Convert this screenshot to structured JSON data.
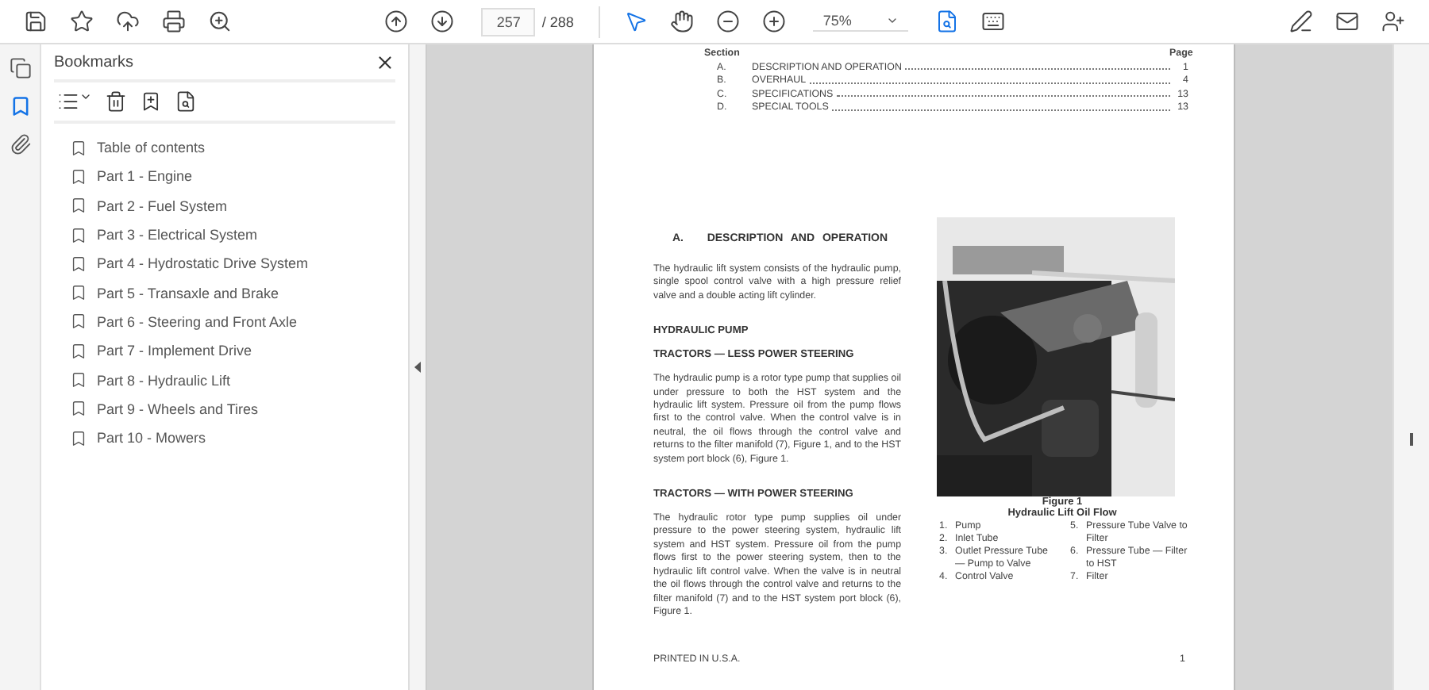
{
  "toolbar": {
    "page_current": "257",
    "page_total": "/ 288",
    "zoom": "75%"
  },
  "rail": [
    {
      "kind": "pages",
      "selected": false
    },
    {
      "kind": "bookmarks",
      "selected": true
    },
    {
      "kind": "attachments",
      "selected": false
    }
  ],
  "sidebar": {
    "title": "Bookmarks",
    "items": [
      {
        "label": "Table of contents"
      },
      {
        "label": "Part 1 - Engine"
      },
      {
        "label": "Part 2 - Fuel System"
      },
      {
        "label": "Part 3 - Electrical System"
      },
      {
        "label": "Part 4 - Hydrostatic Drive System"
      },
      {
        "label": "Part 5 - Transaxle and Brake"
      },
      {
        "label": "Part 6 - Steering and Front Axle"
      },
      {
        "label": "Part 7 - Implement Drive"
      },
      {
        "label": "Part 8 - Hydraulic Lift"
      },
      {
        "label": "Part 9 - Wheels and Tires"
      },
      {
        "label": "Part 10 - Mowers"
      }
    ]
  },
  "page": {
    "toc": {
      "section_heading": "Section",
      "page_heading": "Page",
      "rows": [
        {
          "letter": "A.",
          "title": "DESCRIPTION AND OPERATION",
          "page": "1"
        },
        {
          "letter": "B.",
          "title": "OVERHAUL",
          "page": "4"
        },
        {
          "letter": "C.",
          "title": "SPECIFICATIONS",
          "page": "13"
        },
        {
          "letter": "D.",
          "title": "SPECIAL TOOLS",
          "page": "13"
        }
      ]
    },
    "heading": "A.   DESCRIPTION AND OPERATION",
    "blocks": [
      {
        "kind": "paragraph",
        "text": "The hydraulic lift system consists of the hydraulic pump, single spool control valve with a high pressure relief valve and a double acting lift cylinder."
      },
      {
        "kind": "subheading",
        "text": "HYDRAULIC PUMP"
      },
      {
        "kind": "subheading",
        "text": "TRACTORS — LESS POWER STEERING"
      },
      {
        "kind": "paragraph",
        "text": "The hydraulic pump is a rotor type pump that supplies oil under pressure to both the HST system and the hydraulic lift system. Pressure oil from the pump flows first to the control valve. When the control valve is in neutral, the oil flows through the control valve and returns to the filter manifold (7), Figure 1, and to the HST system port block (6), Figure 1."
      },
      {
        "kind": "subheading",
        "text": "TRACTORS — WITH POWER STEERING"
      },
      {
        "kind": "paragraph",
        "text": "The hydraulic rotor type pump supplies oil under pressure to the power steering system, hydraulic lift system and HST system. Pressure oil from the pump flows first to the power steering system, then to the hydraulic lift control valve. When the valve is in neutral the oil flows through the control valve and returns to the filter manifold (7) and to the HST system port block (6), Figure 1."
      }
    ],
    "figure": {
      "kind": "picture",
      "number": "Figure 1",
      "title": "Hydraulic Lift Oil Flow",
      "legend_left": [
        {
          "num": "1.",
          "text": "Pump"
        },
        {
          "num": "2.",
          "text": "Inlet Tube"
        },
        {
          "num": "3.",
          "text": "Outlet Pressure Tube — Pump to Valve"
        },
        {
          "num": "4.",
          "text": "Control Valve"
        }
      ],
      "legend_right": [
        {
          "num": "5.",
          "text": "Pressure Tube Valve to Filter"
        },
        {
          "num": "6.",
          "text": "Pressure Tube — Filter to HST"
        },
        {
          "num": "7.",
          "text": "Filter"
        }
      ]
    },
    "footer": "PRINTED IN U.S.A.",
    "page_number": "1"
  }
}
